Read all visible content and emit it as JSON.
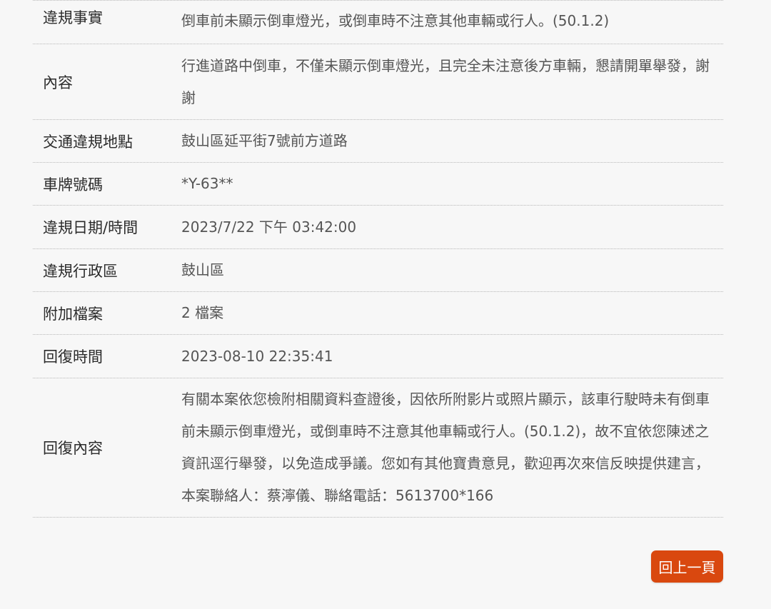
{
  "rows": [
    {
      "label": "違規事實",
      "value": "倒車前未顯示倒車燈光，或倒車時不注意其他車輛或行人。(50.1.2)"
    },
    {
      "label": "內容",
      "value": "行進道路中倒車，不僅未顯示倒車燈光，且完全未注意後方車輛，懇請開單舉發，謝謝"
    },
    {
      "label": "交通違規地點",
      "value": "鼓山區延平街7號前方道路"
    },
    {
      "label": "車牌號碼",
      "value": "*Y-63**"
    },
    {
      "label": "違規日期/時間",
      "value": "2023/7/22 下午 03:42:00"
    },
    {
      "label": "違規行政區",
      "value": "鼓山區"
    },
    {
      "label": "附加檔案",
      "value": "2 檔案"
    },
    {
      "label": "回復時間",
      "value": "2023-08-10 22:35:41"
    },
    {
      "label": "回復內容",
      "value": "有關本案依您檢附相關資料查證後，因依所附影片或照片顯示，該車行駛時未有倒車前未顯示倒車燈光，或倒車時不注意其他車輛或行人。(50.1.2)，故不宜依您陳述之資訊逕行舉發，以免造成爭議。您如有其他寶貴意見，歡迎再次來信反映提供建言，本案聯絡人：蔡濘儀、聯絡電話：5613700*166"
    }
  ],
  "back_button": {
    "label": "回上一頁"
  },
  "colors": {
    "accent": "#d9480f",
    "background": "#f7f7f7",
    "label_text": "#2b2b2b",
    "value_text": "#555555"
  }
}
